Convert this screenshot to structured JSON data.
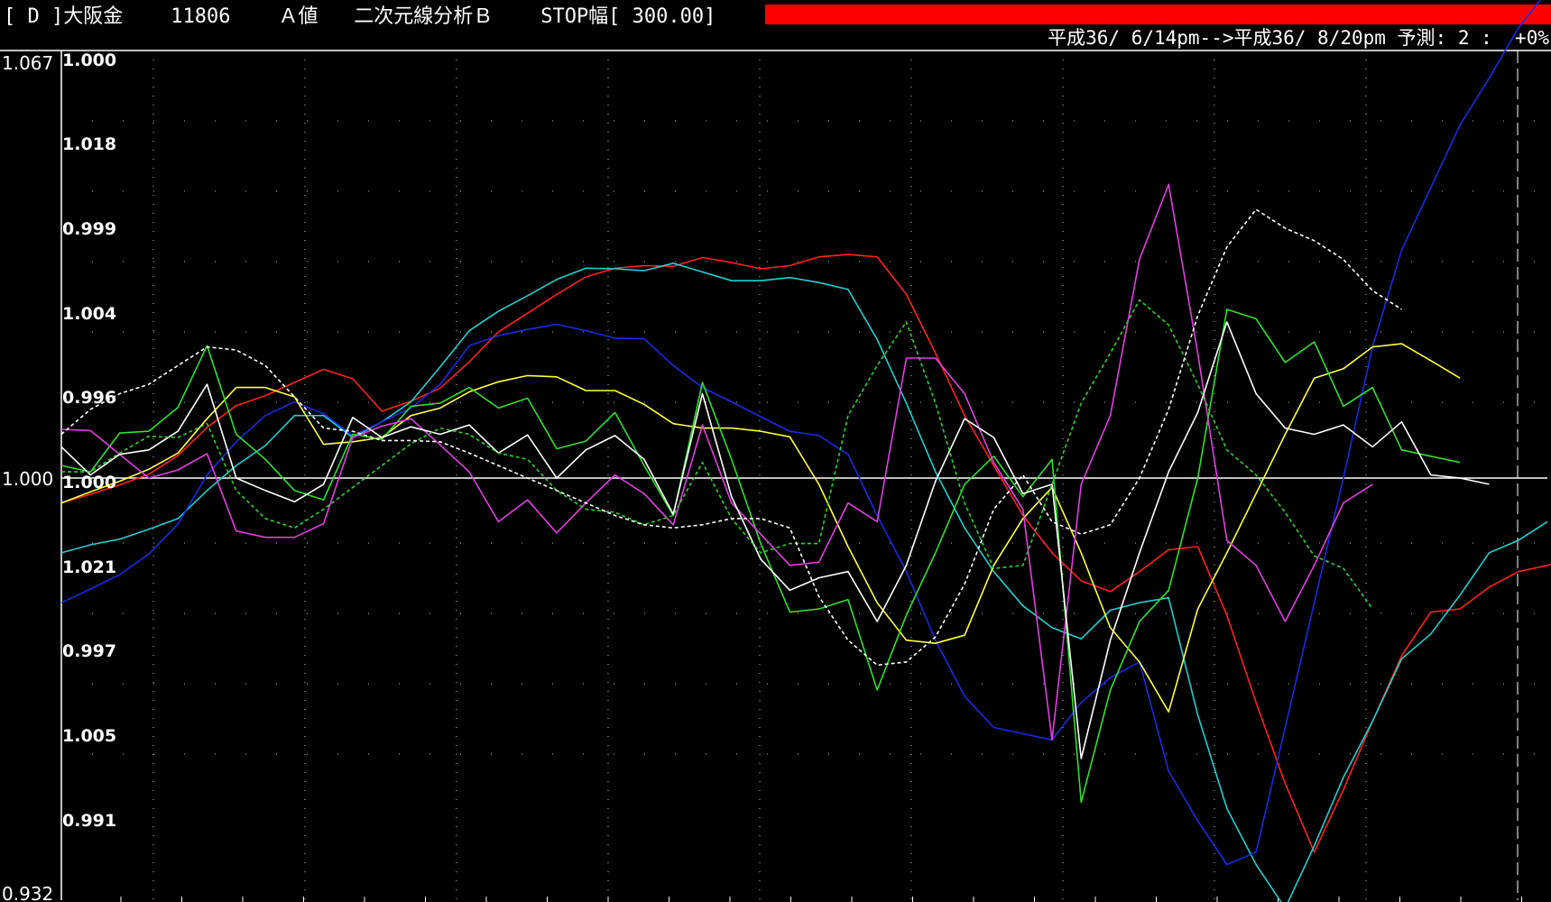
{
  "header": {
    "market": "[ D ]大阪金",
    "code": "11806",
    "mode": "Ａ値",
    "analysis": "二次元線分析Ｂ",
    "stop": "STOP幅[ 300.00]",
    "period": "平成36/ 6/14pm-->平成36/ 8/20pm 予測: 2 :  +0%",
    "alert_color": "#ff0000"
  },
  "chart_data": {
    "type": "line",
    "left_labels": {
      "top": "1.067",
      "base": "1.000",
      "bottom": "0.932"
    },
    "inner_labels": [
      "1.000",
      "1.018",
      "0.999",
      "1.004",
      "0.996",
      "1.000",
      "1.021",
      "0.997",
      "1.005",
      "0.991"
    ],
    "ylim": [
      0.932,
      1.067
    ],
    "base_value": 1.0,
    "x_count": 52,
    "series": [
      {
        "color": "#ff2020",
        "dashed": false,
        "values": [
          0.996,
          0.9974,
          0.9989,
          1.0006,
          1.0036,
          1.0081,
          1.0116,
          1.0132,
          1.0153,
          1.0174,
          1.0159,
          1.0107,
          1.0123,
          1.0144,
          1.0186,
          1.0234,
          1.0264,
          1.0294,
          1.0322,
          1.0336,
          1.034,
          1.0339,
          1.0353,
          1.0345,
          1.0335,
          1.034,
          1.0354,
          1.0358,
          1.0354,
          1.0294,
          1.02,
          1.01,
          1.002,
          0.994,
          0.988,
          0.9835,
          0.9818,
          0.985,
          0.9885,
          0.989,
          0.978,
          0.964,
          0.951,
          0.94,
          0.95,
          0.961,
          0.9715,
          0.9785,
          0.979,
          0.9825,
          0.985,
          0.986,
          0.9875
        ]
      },
      {
        "color": "#20d0d0",
        "dashed": false,
        "values": [
          0.988,
          0.9893,
          0.9902,
          0.9918,
          0.9935,
          0.998,
          1.002,
          1.0052,
          1.01,
          1.01,
          1.0065,
          1.009,
          1.0122,
          1.0178,
          1.0236,
          1.0267,
          1.0292,
          1.0318,
          1.0336,
          1.0335,
          1.0332,
          1.0344,
          1.033,
          1.0316,
          1.0316,
          1.0321,
          1.0313,
          1.0302,
          1.0222,
          1.012,
          1.001,
          0.992,
          0.985,
          0.9795,
          0.976,
          0.9742,
          0.9788,
          0.98,
          0.9808,
          0.962,
          0.947,
          0.938,
          0.931,
          0.941,
          0.952,
          0.961,
          0.971,
          0.975,
          0.9812,
          0.988,
          0.99,
          0.993
        ]
      },
      {
        "color": "#1a2ae0",
        "dashed": false,
        "values": [
          0.98,
          0.9822,
          0.9845,
          0.9878,
          0.9926,
          1.0005,
          1.0058,
          1.01,
          1.0122,
          1.0103,
          1.0068,
          1.009,
          1.0112,
          1.015,
          1.0212,
          1.0228,
          1.0238,
          1.0246,
          1.0236,
          1.0224,
          1.0223,
          1.018,
          1.0145,
          1.0122,
          1.0098,
          1.0075,
          1.0068,
          1.0038,
          0.994,
          0.985,
          0.974,
          0.965,
          0.96,
          0.959,
          0.958,
          0.964,
          0.968,
          0.9705,
          0.953,
          0.945,
          0.938,
          0.94,
          0.96,
          0.98,
          1.0,
          1.021,
          1.0365,
          1.0465,
          1.0565,
          1.064,
          1.072,
          1.078
        ]
      },
      {
        "color": "#ffff40",
        "dashed": false,
        "values": [
          0.996,
          0.9978,
          0.9995,
          1.0014,
          1.004,
          1.0095,
          1.0145,
          1.0145,
          1.013,
          1.0054,
          1.0058,
          1.0065,
          1.01,
          1.0112,
          1.0138,
          1.0154,
          1.0164,
          1.0162,
          1.014,
          1.014,
          1.0118,
          1.0087,
          1.008,
          1.008,
          1.0075,
          1.0066,
          0.999,
          0.989,
          0.98,
          0.974,
          0.9735,
          0.9748,
          0.986,
          0.9935,
          0.9985,
          0.988,
          0.976,
          0.9705,
          0.9625,
          0.979,
          0.988,
          0.9975,
          1.007,
          1.016,
          1.0175,
          1.021,
          1.0215,
          1.0188,
          1.016
        ]
      },
      {
        "color": "#30e030",
        "dashed": false,
        "values": [
          1.002,
          1.001,
          1.0072,
          1.0075,
          1.0113,
          1.0212,
          1.007,
          1.003,
          0.998,
          0.9965,
          1.007,
          1.0062,
          1.0115,
          1.012,
          1.0145,
          1.0112,
          1.0128,
          1.0047,
          1.0059,
          1.0105,
          1.002,
          0.994,
          1.0153,
          1.003,
          0.9895,
          0.9785,
          0.979,
          0.9805,
          0.966,
          0.978,
          0.988,
          0.999,
          1.0035,
          0.997,
          1.003,
          0.948,
          0.966,
          0.977,
          0.982,
          1.0,
          1.027,
          1.0255,
          1.0185,
          1.0218,
          1.0115,
          1.0145,
          1.0045,
          1.0035,
          1.0025
        ]
      },
      {
        "color": "#e040e0",
        "dashed": false,
        "values": [
          1.0078,
          1.0076,
          1.0038,
          1.0,
          1.0013,
          1.0039,
          0.9915,
          0.9905,
          0.9905,
          0.9927,
          1.0065,
          1.0083,
          1.0095,
          1.0053,
          1.001,
          0.993,
          0.9965,
          0.9912,
          0.996,
          1.0005,
          0.9975,
          0.9925,
          1.0085,
          0.996,
          0.991,
          0.986,
          0.9865,
          0.996,
          0.993,
          1.0192,
          1.0192,
          1.0135,
          1.0025,
          0.995,
          0.958,
          0.999,
          1.01,
          1.035,
          1.047,
          1.02,
          0.99,
          0.986,
          0.977,
          0.986,
          0.996,
          0.999
        ]
      },
      {
        "color": "#ffffff",
        "dashed": false,
        "values": [
          1.005,
          1.0005,
          1.0038,
          1.0045,
          1.0075,
          1.015,
          1.0,
          0.998,
          0.9962,
          0.999,
          1.0097,
          1.0065,
          1.0082,
          1.007,
          1.0085,
          1.004,
          1.0069,
          1.0,
          1.0045,
          1.0068,
          1.003,
          0.9942,
          1.0135,
          0.997,
          0.987,
          0.982,
          0.984,
          0.985,
          0.977,
          0.986,
          0.9995,
          1.0095,
          1.0065,
          0.9975,
          0.999,
          0.955,
          0.974,
          0.988,
          1.001,
          1.0105,
          1.025,
          1.0135,
          1.008,
          1.007,
          1.0085,
          1.005,
          1.009,
          1.0005,
          1.0,
          0.999
        ]
      },
      {
        "color": "#30d030",
        "dashed": true,
        "values": [
          1.001,
          1.001,
          1.004,
          1.0067,
          1.0065,
          1.0087,
          0.998,
          0.9935,
          0.992,
          0.995,
          0.9985,
          1.002,
          1.0055,
          1.008,
          1.007,
          1.004,
          1.003,
          0.998,
          0.995,
          0.9945,
          0.9925,
          0.994,
          1.0025,
          0.9935,
          0.988,
          0.9895,
          0.9895,
          1.01,
          1.018,
          1.025,
          1.012,
          0.996,
          0.9855,
          0.986,
          0.999,
          1.012,
          1.02,
          1.0285,
          1.0245,
          1.015,
          1.0045,
          1.0005,
          0.9945,
          0.9875,
          0.9855,
          0.979
        ]
      },
      {
        "color": "#ffffff",
        "dashed": true,
        "values": [
          1.007,
          1.011,
          1.0135,
          1.015,
          1.018,
          1.021,
          1.0205,
          1.018,
          1.013,
          1.008,
          1.0075,
          1.006,
          1.006,
          1.0058,
          1.004,
          1.002,
          1.0,
          0.998,
          0.996,
          0.994,
          0.9925,
          0.992,
          0.9925,
          0.9935,
          0.9935,
          0.992,
          0.981,
          0.974,
          0.97,
          0.9705,
          0.9745,
          0.983,
          0.995,
          1.0005,
          0.993,
          0.991,
          0.9925,
          1.0,
          1.011,
          1.026,
          1.037,
          1.043,
          1.04,
          1.038,
          1.035,
          1.03,
          1.027
        ]
      }
    ]
  }
}
